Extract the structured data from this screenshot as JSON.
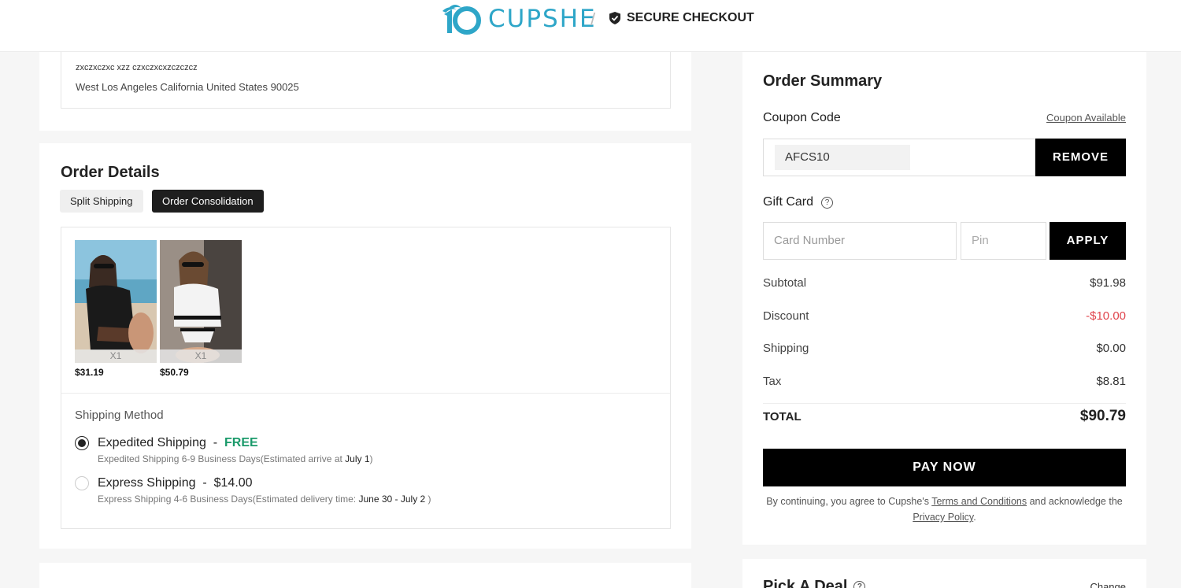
{
  "header": {
    "brand": "CUPSHE",
    "brand_color": "#2ea6c8",
    "separator": "/",
    "secure_label": "SECURE CHECKOUT"
  },
  "address": {
    "line1": "zxczxczxc xzz czxczxcxzczczcz",
    "line2": "West Los Angeles California United States 90025"
  },
  "order_details": {
    "title": "Order Details",
    "tabs": [
      {
        "label": "Split Shipping",
        "active": false
      },
      {
        "label": "Order Consolidation",
        "active": true
      }
    ],
    "items": [
      {
        "qty": "X1",
        "price": "$31.19"
      },
      {
        "qty": "X1",
        "price": "$50.79"
      }
    ],
    "shipping_method_label": "Shipping Method",
    "shipping_options": [
      {
        "name": "Expedited Shipping",
        "dash": "-",
        "price": "FREE",
        "selected": true,
        "desc": "Expedited Shipping 6-9 Business Days(Estimated arrive at ",
        "date": "July 1",
        "desc_end": ")"
      },
      {
        "name": "Express Shipping",
        "dash": "-",
        "price": "$14.00",
        "selected": false,
        "desc": "Express Shipping 4-6 Business Days(Estimated delivery time: ",
        "date": "June 30 - July 2",
        "desc_end": " )"
      }
    ]
  },
  "summary": {
    "title": "Order Summary",
    "coupon_label": "Coupon Code",
    "coupon_available": "Coupon Available",
    "coupon_value": "AFCS10",
    "remove_label": "REMOVE",
    "gift_label": "Gift Card",
    "card_placeholder": "Card Number",
    "pin_placeholder": "Pin",
    "apply_label": "APPLY",
    "rows": [
      {
        "label": "Subtotal",
        "value": "$91.98"
      },
      {
        "label": "Discount",
        "value": "-$10.00"
      },
      {
        "label": "Shipping",
        "value": "$0.00"
      },
      {
        "label": "Tax",
        "value": "$8.81"
      }
    ],
    "total_label": "TOTAL",
    "total_value": "$90.79",
    "pay_label": "PAY NOW",
    "terms_prefix": "By continuing, you agree to Cupshe's ",
    "terms_link": "Terms and Conditions",
    "terms_mid": " and acknowledge the ",
    "privacy_link": "Privacy Policy",
    "terms_suffix": "."
  },
  "deal": {
    "title": "Pick A Deal",
    "change_label": "Change"
  },
  "colors": {
    "discount": "#e0454d",
    "free": "#1a9a6a",
    "button": "#000000"
  }
}
